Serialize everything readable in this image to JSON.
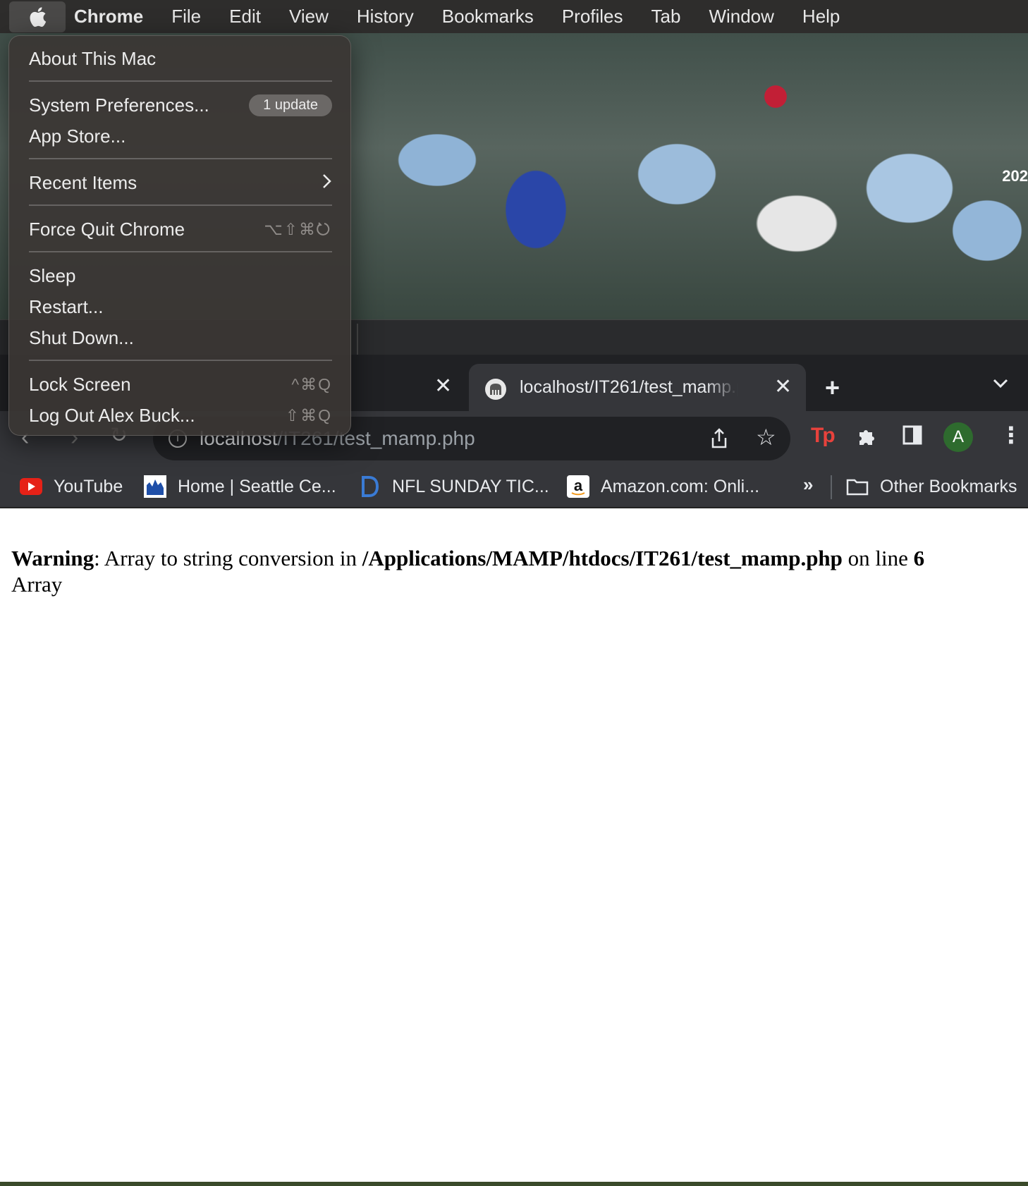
{
  "menubar": {
    "app_name": "Chrome",
    "items": [
      "File",
      "Edit",
      "View",
      "History",
      "Bookmarks",
      "Profiles",
      "Tab",
      "Window",
      "Help"
    ]
  },
  "apple_menu": {
    "about": "About This Mac",
    "system_prefs": "System Preferences...",
    "update_badge": "1 update",
    "app_store": "App Store...",
    "recent_items": "Recent Items",
    "force_quit": "Force Quit Chrome",
    "force_quit_shortcut": "⌥⇧⌘",
    "sleep": "Sleep",
    "restart": "Restart...",
    "shut_down": "Shut Down...",
    "lock_screen": "Lock Screen",
    "lock_shortcut": "^⌘Q",
    "log_out": "Log Out Alex Buck...",
    "log_out_shortcut": "⇧⌘Q"
  },
  "photo": {
    "year_text": "202"
  },
  "tab": {
    "title": "localhost/IT261/test_mamp.php"
  },
  "omnibox": {
    "url_host": "localhost",
    "url_path": "/IT261/test_mamp.php"
  },
  "profile_initial": "A",
  "bookmarks": {
    "items": [
      {
        "label": "YouTube",
        "icon": "youtube-icon"
      },
      {
        "label": "Home | Seattle Ce...",
        "icon": "seattle-center-icon"
      },
      {
        "label": "NFL SUNDAY TIC...",
        "icon": "directv-icon"
      },
      {
        "label": "Amazon.com: Onli...",
        "icon": "amazon-icon"
      }
    ],
    "overflow": "»",
    "other": "Other Bookmarks"
  },
  "page": {
    "warning_label": "Warning",
    "warning_text_1": ": Array to string conversion in ",
    "warning_file": "/Applications/MAMP/htdocs/IT261/test_mamp.php",
    "warning_text_2": " on line ",
    "warning_line": "6",
    "output": "Array"
  },
  "colors": {
    "menubar_bg": "#2e2d2c",
    "tabstrip_bg": "#202124",
    "toolbar_bg": "#35363a",
    "avatar_bg": "#2e6b2e"
  }
}
